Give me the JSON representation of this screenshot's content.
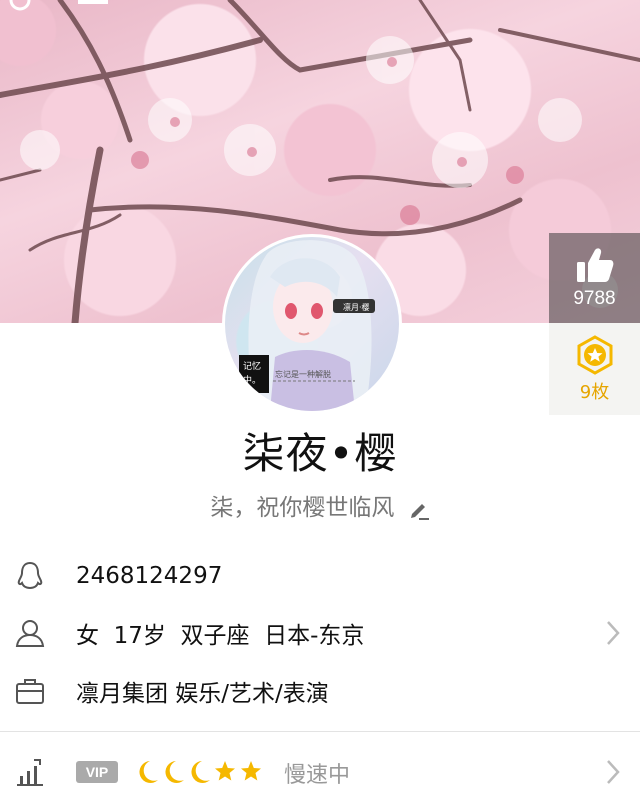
{
  "cover": {
    "image": "cherry-blossom-cover"
  },
  "like": {
    "icon": "thumbs-up-icon",
    "count": "9788"
  },
  "medal": {
    "icon": "star-medal-icon",
    "count": "9枚"
  },
  "avatar": {
    "image": "anime-girl-avatar"
  },
  "profile": {
    "name": "柒夜•樱",
    "signature": "柒，祝你樱世临风"
  },
  "info": {
    "qq_number": "2468124297",
    "basic": "女  17岁  双子座  日本-东京",
    "company": "凛月集团 娱乐/艺术/表演"
  },
  "vip": {
    "badge": "VIP",
    "level_icons": [
      "moon",
      "moon",
      "moon",
      "star",
      "star"
    ],
    "status": "慢速中"
  },
  "colors": {
    "accent_gold": "#f5b800",
    "text_gray": "#777777",
    "badge_gray": "#aaaaaa"
  }
}
